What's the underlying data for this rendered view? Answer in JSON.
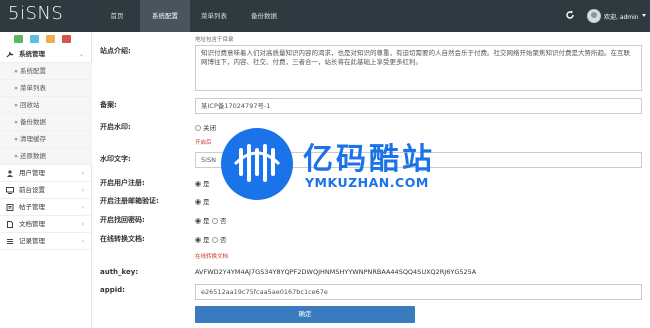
{
  "header": {
    "logo": "5iSNS",
    "nav": [
      "首页",
      "系统配置",
      "菜单列表",
      "备份数据"
    ],
    "active_nav": "系统配置",
    "welcome": "欢迎, admin"
  },
  "sidebar": {
    "section_open": "系统管理",
    "sub_items": [
      "» 系统配置",
      "» 菜单列表",
      "» 回收站",
      "» 备份数据",
      "» 清理缓存",
      "» 还原数据"
    ],
    "sections": [
      "用户管理",
      "前台设置",
      "帖子管理",
      "文档管理",
      "记录管理"
    ]
  },
  "form": {
    "top_hint": "地址包含于目录",
    "intro_label": "站点介绍:",
    "intro_value": "知识付费意味着人们对高质量知识内容的渴求，也是对知识的尊重，有迫切需要的人自然会乐于付费。社交网络开始聚焦知识付费是大势所趋。在互联网博往下，内容、社交、付费，三者合一，站长将在此基础上享受更多红利。",
    "icp_label": "备案:",
    "icp_value": "某ICP备17024797号-1",
    "watermark_label": "开启水印:",
    "watermark_off": "关闭",
    "watermark_hint": "开启后",
    "watermark_text_label": "水印文字:",
    "watermark_text_value": "5iSN",
    "reg_label": "开启用户注册:",
    "mail_label": "开启注册邮箱验证:",
    "findpw_label": "开启找回密码:",
    "online_label": "在线转换文档:",
    "online_hint": "在线转换文档",
    "yes": "是",
    "no": "否",
    "auth_label": "auth_key:",
    "auth_value": "AVFWD2Y4YM4AJ7GS34Y8YQPF2DWQJHNMSHYYWNPNRBAA44SQQ4SUXQ2RJ6YG525A",
    "appid_label": "appid:",
    "appid_value": "e26512aa19c75fcaa5ae0167bc1ce67e",
    "submit": "确定"
  },
  "watermark": {
    "title": "亿码酷站",
    "subtitle": "YMKUZHAN.COM"
  },
  "colors": {
    "topbar": "#2f3940",
    "active_nav": "#48555e",
    "submit": "#3a7bbf",
    "watermark": "#1a73e8",
    "hint": "#c0392b"
  }
}
